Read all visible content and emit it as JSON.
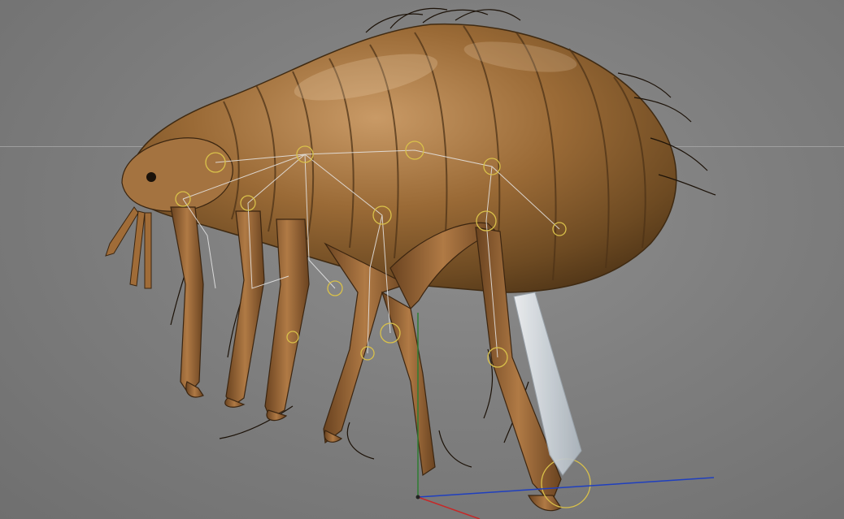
{
  "viewport": {
    "name": "3D viewport",
    "background_color": "#808080",
    "horizon_color": "#a6a6a6",
    "label": ""
  },
  "model": {
    "subject": "flea",
    "body_colors": [
      "#8b5a2b",
      "#6b4a22",
      "#a7703f",
      "#c2895c"
    ],
    "rig_joint_color": "#d9c14a",
    "rig_bone_color": "#e8e8e8"
  },
  "gizmo": {
    "x_axis_color": "#c62828",
    "y_axis_color": "#2e7d32",
    "z_axis_color": "#1f3fbf"
  },
  "ik_effector": {
    "color": "#dfe3e8"
  }
}
